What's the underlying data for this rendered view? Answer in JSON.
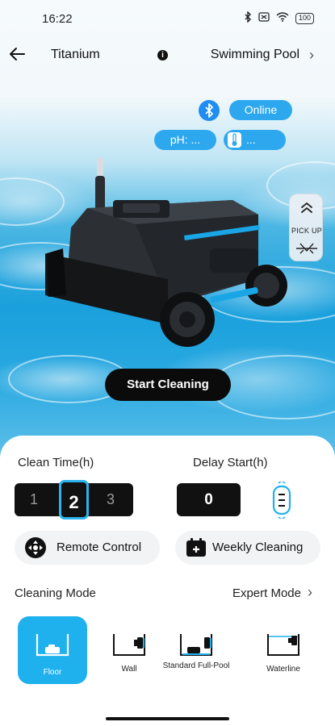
{
  "status_bar": {
    "time": "16:22",
    "battery": "100"
  },
  "header": {
    "device_name": "Titanium",
    "pool_name": "Swimming Pool"
  },
  "badges": {
    "connection": "Online",
    "ph": "pH: ...",
    "temperature": "..."
  },
  "hero": {
    "start_button": "Start Cleaning",
    "pickup_label": "PICK UP"
  },
  "clean_time": {
    "label": "Clean Time(h)",
    "options": [
      "1",
      "2",
      "3"
    ],
    "selected": "2"
  },
  "delay_start": {
    "label": "Delay Start(h)",
    "value": "0"
  },
  "actions": {
    "remote": "Remote Control",
    "weekly": "Weekly Cleaning"
  },
  "modes": {
    "label": "Cleaning Mode",
    "expert": "Expert Mode",
    "items": [
      {
        "label": "Floor",
        "active": true
      },
      {
        "label": "Wall",
        "active": false
      },
      {
        "label": "Standard Full-Pool",
        "active": false
      },
      {
        "label": "Waterline",
        "active": false
      }
    ]
  },
  "colors": {
    "accent": "#1fb0ee",
    "pill": "#2da8ee",
    "dark": "#111111"
  }
}
